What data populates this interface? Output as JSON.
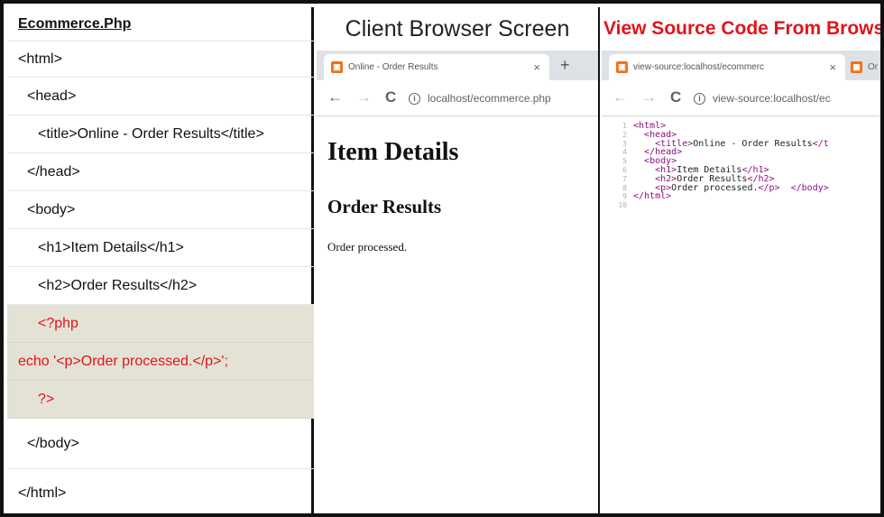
{
  "php_panel": {
    "title": "Ecommerce.Php",
    "lines": [
      "<html>",
      "<head>",
      "<title>Online - Order Results</title>",
      "</head>",
      "<body>",
      "<h1>Item Details</h1>",
      "<h2>Order Results</h2>",
      "<?php",
      "echo '<p>Order processed.</p>';",
      "?>",
      "</body>",
      "</html>"
    ]
  },
  "client_panel": {
    "heading": "Client Browser Screen",
    "tab_title": "Online - Order Results",
    "tab_close": "×",
    "new_tab": "+",
    "nav_back": "←",
    "nav_forward": "→",
    "nav_reload": "C",
    "url": "localhost/ecommerce.php",
    "page": {
      "h1": "Item Details",
      "h2": "Order Results",
      "p": "Order processed."
    }
  },
  "source_panel": {
    "heading": "View Source Code From Browser",
    "tab_title": "view-source:localhost/ecommerc",
    "tab_close": "×",
    "second_tab_title": "Or",
    "nav_back": "←",
    "nav_forward": "→",
    "nav_reload": "C",
    "url": "view-source:localhost/ec",
    "code_lines": [
      {
        "num": "1",
        "tag_open": "<html>",
        "text": "",
        "tag_close": ""
      },
      {
        "num": "2",
        "tag_open": "<head>",
        "text": "",
        "tag_close": ""
      },
      {
        "num": "3",
        "tag_open": "<title>",
        "text": "Online - Order Results",
        "tag_close": "</t"
      },
      {
        "num": "4",
        "tag_open": "</head>",
        "text": "",
        "tag_close": ""
      },
      {
        "num": "5",
        "tag_open": "<body>",
        "text": "",
        "tag_close": ""
      },
      {
        "num": "6",
        "tag_open": "<h1>",
        "text": "Item Details",
        "tag_close": "</h1>"
      },
      {
        "num": "7",
        "tag_open": "<h2>",
        "text": "Order Results",
        "tag_close": "</h2>"
      },
      {
        "num": "8",
        "tag_open": "<p>",
        "text": "Order processed.",
        "tag_close": "</p>  </body>"
      },
      {
        "num": "9",
        "tag_open": "</html>",
        "text": "",
        "tag_close": ""
      },
      {
        "num": "10",
        "tag_open": "",
        "text": "",
        "tag_close": ""
      }
    ]
  },
  "colors": {
    "php_highlight": "#e4e2d5",
    "php_text": "#e0141b",
    "source_heading": "#e0141b",
    "tag_color": "#881280",
    "favicon": "#f07019"
  }
}
